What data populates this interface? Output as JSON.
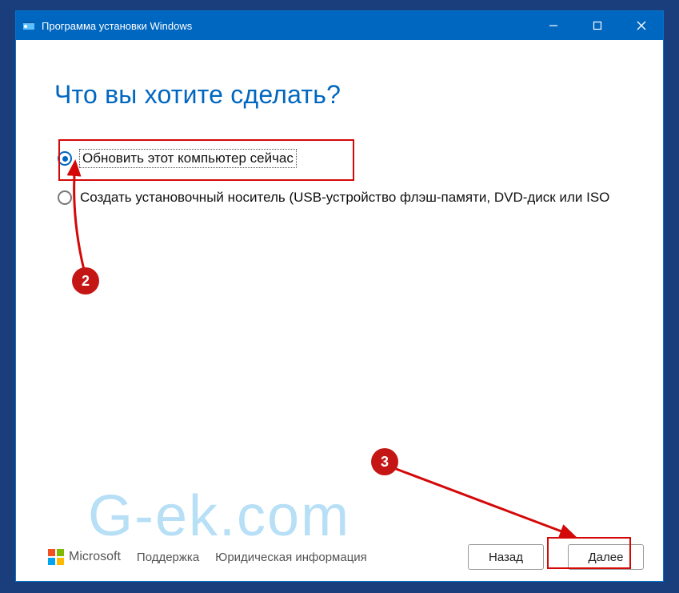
{
  "window": {
    "title": "Программа установки Windows"
  },
  "content": {
    "heading": "Что вы хотите сделать?",
    "options": [
      {
        "label": "Обновить этот компьютер сейчас",
        "selected": true
      },
      {
        "label": "Создать установочный носитель (USB-устройство флэш-памяти, DVD-диск или ISO",
        "selected": false
      }
    ]
  },
  "footer": {
    "vendor": "Microsoft",
    "link_support": "Поддержка",
    "link_legal": "Юридическая информация",
    "btn_back": "Назад",
    "btn_next": "Далее"
  },
  "annotations": {
    "step2": "2",
    "step3": "3"
  },
  "watermark": "G-ek.com",
  "colors": {
    "accent": "#0067c0",
    "highlight": "#d40808",
    "badge": "#c51616"
  }
}
